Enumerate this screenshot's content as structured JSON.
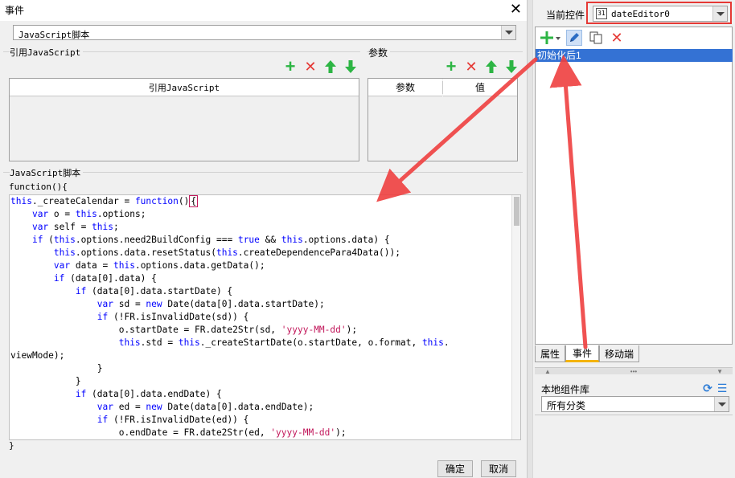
{
  "dialog": {
    "title": "事件",
    "close_glyph": "✕",
    "script_type": "JavaScript脚本",
    "ref_section_label": "引用JavaScript",
    "ref_table_header": "引用JavaScript",
    "params_section_label": "参数",
    "params_headers": [
      "参数",
      "值"
    ],
    "script_section_label": "JavaScript脚本",
    "func_open": "function(){",
    "func_close": "}",
    "ok_label": "确定",
    "cancel_label": "取消",
    "toolbar_icons": [
      "add-icon",
      "delete-icon",
      "move-up-icon",
      "move-down-icon"
    ]
  },
  "code": {
    "lines": [
      "this._createCalendar = function(){",
      "    var o = this.options;",
      "    var self = this;",
      "    if (this.options.need2BuildConfig === true && this.options.data) {",
      "        this.options.data.resetStatus(this.createDependencePara4Data());",
      "        var data = this.options.data.getData();",
      "        if (data[0].data) {",
      "            if (data[0].data.startDate) {",
      "                var sd = new Date(data[0].data.startDate);",
      "                if (!FR.isInvalidDate(sd)) {",
      "                    o.startDate = FR.date2Str(sd, 'yyyy-MM-dd');",
      "                    this.std = this._createStartDate(o.startDate, o.format, this.",
      "viewMode);",
      "                }",
      "            }",
      "            if (data[0].data.endDate) {",
      "                var ed = new Date(data[0].data.endDate);",
      "                if (!FR.isInvalidDate(ed)) {",
      "                    o.endDate = FR.date2Str(ed, 'yyyy-MM-dd');"
    ]
  },
  "right_panel": {
    "current_widget_label": "当前控件",
    "current_widget_value": "dateEditor0",
    "calendar_icon_text": "31",
    "event_item": "初始化后1",
    "event_toolbar_icons": [
      "add-dropdown-icon",
      "edit-pencil-icon",
      "copy-icon",
      "delete-icon"
    ],
    "tabs": [
      "属性",
      "事件",
      "移动端"
    ],
    "active_tab": "事件",
    "library_label": "本地组件库",
    "library_category": "所有分类"
  },
  "colors": {
    "selection": "#3472d4",
    "annotation_red": "#e53935",
    "tab_accent": "#f4b400",
    "keyword": "#0000ff",
    "string": "#c2185b"
  }
}
